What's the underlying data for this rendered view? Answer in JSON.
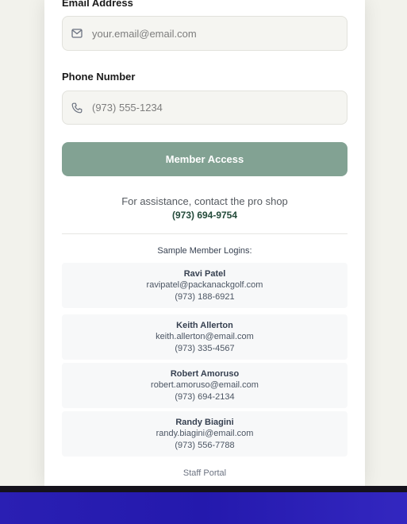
{
  "form": {
    "email_label": "Email Address",
    "email_placeholder": "your.email@email.com",
    "email_icon": "envelope-icon",
    "phone_label": "Phone Number",
    "phone_placeholder": "(973) 555-1234",
    "phone_icon": "phone-icon",
    "submit_label": "Member Access"
  },
  "assistance": {
    "text": "For assistance, contact the pro shop",
    "phone": "(973) 694-9754"
  },
  "samples": {
    "title": "Sample Member Logins:",
    "members": [
      {
        "name": "Ravi Patel",
        "email": "ravipatel@packanackgolf.com",
        "phone": "(973) 188-6921"
      },
      {
        "name": "Keith Allerton",
        "email": "keith.allerton@email.com",
        "phone": "(973) 335-4567"
      },
      {
        "name": "Robert Amoruso",
        "email": "robert.amoruso@email.com",
        "phone": "(973) 694-2134"
      },
      {
        "name": "Randy Biagini",
        "email": "randy.biagini@email.com",
        "phone": "(973) 556-7788"
      }
    ]
  },
  "staff_link": "Staff Portal",
  "colors": {
    "accent_button": "#82a293",
    "assist_phone": "#234a3a",
    "bottom_bar": "#2419ad"
  }
}
